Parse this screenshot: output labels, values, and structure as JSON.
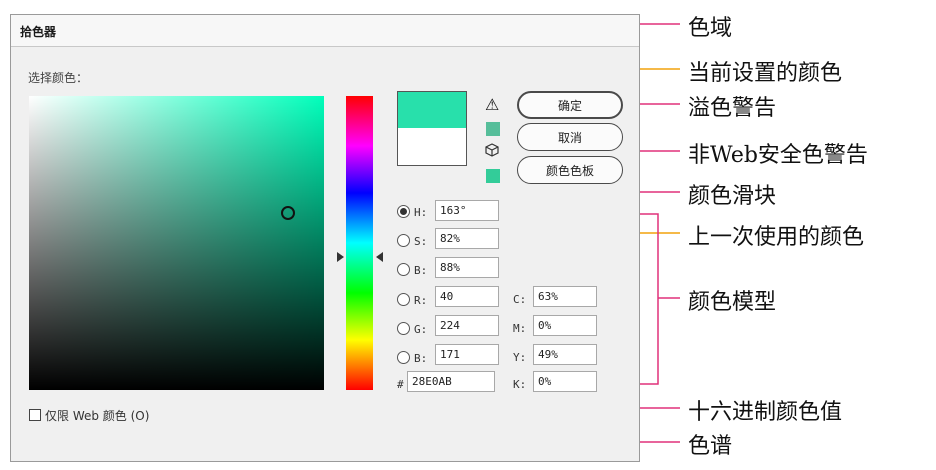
{
  "dialog": {
    "title": "拾色器",
    "pick_label": "选择颜色：",
    "buttons": {
      "ok": "确定",
      "cancel": "取消",
      "swatches": "颜色色板"
    },
    "current_color": "#28E0AB",
    "previous_color": "#FFFFFF",
    "gamut_chip_color": "#56BE9A",
    "web_chip_color": "#33CC99",
    "icons": {
      "gamut_warning": "warning-triangle-icon",
      "web_warning": "cube-icon"
    },
    "fields": {
      "h": {
        "label": "H:",
        "value": "163°"
      },
      "s": {
        "label": "S:",
        "value": "82%"
      },
      "b": {
        "label": "B:",
        "value": "88%"
      },
      "r": {
        "label": "R:",
        "value": "40"
      },
      "g": {
        "label": "G:",
        "value": "224"
      },
      "bl": {
        "label": "B:",
        "value": "171"
      },
      "c": {
        "label": "C:",
        "value": "63%"
      },
      "m": {
        "label": "M:",
        "value": "0%"
      },
      "y": {
        "label": "Y:",
        "value": "49%"
      },
      "k": {
        "label": "K:",
        "value": "0%"
      },
      "hex": {
        "label": "#",
        "value": "28E0AB"
      }
    },
    "web_only_label": "仅限 Web 颜色 (O)"
  },
  "annotations": {
    "gamut": "色域",
    "current": "当前设置的颜色",
    "overflow": "溢色警告",
    "web_safe": "非Web安全色警告",
    "slider": "颜色滑块",
    "previous": "上一次使用的颜色",
    "model": "颜色模型",
    "hex": "十六进制颜色值",
    "spectrum": "色谱"
  },
  "colors": {
    "pink_line": "#e0307a",
    "orange_line": "#f2a20c"
  }
}
